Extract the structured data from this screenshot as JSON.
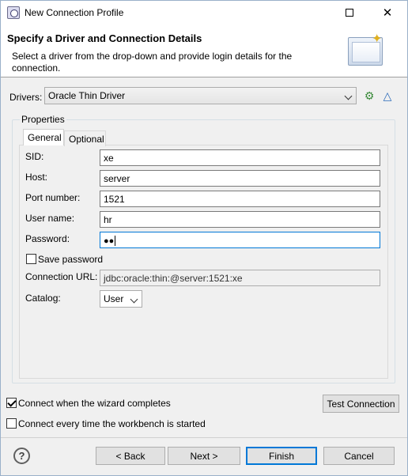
{
  "window": {
    "title": "New Connection Profile"
  },
  "banner": {
    "title": "Specify a Driver and Connection Details",
    "description": "Select a driver from the drop-down and provide login details for the connection."
  },
  "drivers": {
    "label": "Drivers:",
    "selected": "Oracle Thin Driver",
    "new_driver_icon": "new-driver-icon",
    "edit_driver_icon": "edit-driver-icon"
  },
  "properties": {
    "group_label": "Properties",
    "tabs": [
      {
        "label": "General",
        "active": true
      },
      {
        "label": "Optional",
        "active": false
      }
    ],
    "fields": {
      "sid": {
        "label": "SID:",
        "value": "xe"
      },
      "host": {
        "label": "Host:",
        "value": "server"
      },
      "port": {
        "label": "Port number:",
        "value": "1521"
      },
      "user": {
        "label": "User name:",
        "value": "hr"
      },
      "password": {
        "label": "Password:",
        "value": "●●"
      }
    },
    "save_password": {
      "label": "Save password",
      "checked": false
    },
    "connection_url": {
      "label": "Connection URL:",
      "value": "jdbc:oracle:thin:@server:1521:xe"
    },
    "catalog": {
      "label": "Catalog:",
      "selected": "User"
    }
  },
  "options": {
    "connect_when_complete": {
      "label": "Connect when the wizard completes",
      "checked": true
    },
    "connect_every_time": {
      "label": "Connect every time the workbench is started",
      "checked": false
    },
    "test_connection_label": "Test Connection"
  },
  "footer": {
    "back_label": "< Back",
    "next_label": "Next >",
    "finish_label": "Finish",
    "cancel_label": "Cancel"
  },
  "colors": {
    "focus": "#0078d7",
    "window_bg": "#f0f0f0"
  }
}
